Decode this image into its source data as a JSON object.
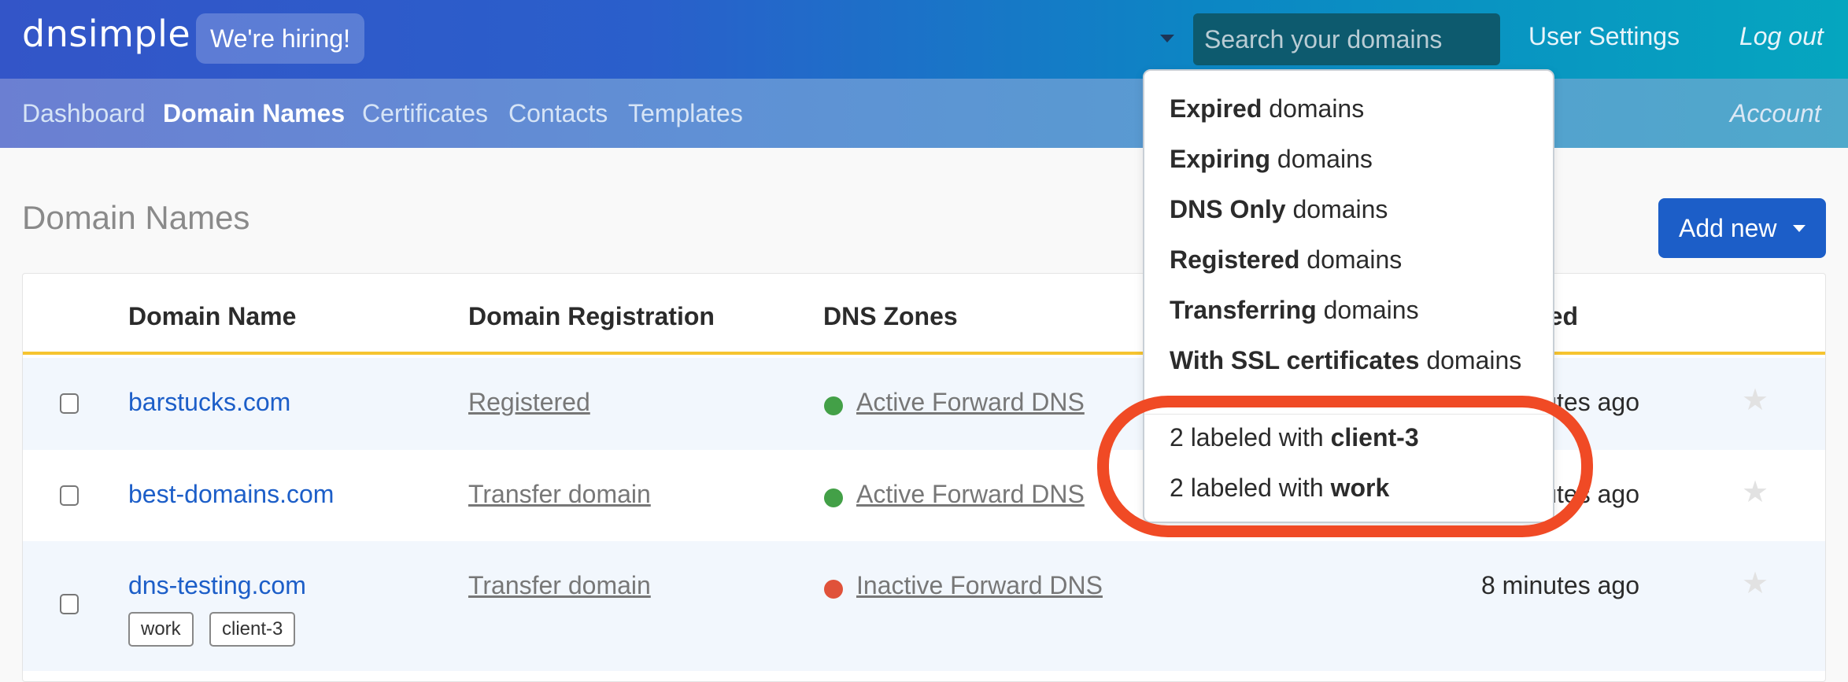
{
  "header": {
    "logo": "dnsimple",
    "hiring_badge": "We're hiring!",
    "search_placeholder": "Search your domains",
    "user_settings": "User Settings",
    "logout": "Log out"
  },
  "subnav": {
    "items": [
      {
        "label": "Dashboard",
        "active": false
      },
      {
        "label": "Domain Names",
        "active": true
      },
      {
        "label": "Certificates",
        "active": false
      },
      {
        "label": "Contacts",
        "active": false
      },
      {
        "label": "Templates",
        "active": false
      }
    ],
    "account": "Account"
  },
  "page": {
    "title": "Domain Names",
    "add_new": "Add new"
  },
  "table": {
    "columns": [
      "Domain Name",
      "Domain Registration",
      "DNS Zones",
      "Updated"
    ],
    "rows": [
      {
        "domain": "barstucks.com",
        "registration": "Registered",
        "dns_status": "active",
        "dns": "Active Forward DNS",
        "updated": "minutes ago",
        "tags": []
      },
      {
        "domain": "best-domains.com",
        "registration": "Transfer domain",
        "dns_status": "active",
        "dns": "Active Forward DNS",
        "updated": "minutes ago",
        "tags": []
      },
      {
        "domain": "dns-testing.com",
        "registration": "Transfer domain",
        "dns_status": "inactive",
        "dns": "Inactive Forward DNS",
        "updated": "8 minutes ago",
        "tags": [
          "work",
          "client-3"
        ]
      }
    ]
  },
  "dropdown": {
    "filters": [
      {
        "bold": "Expired",
        "rest": " domains"
      },
      {
        "bold": "Expiring",
        "rest": " domains"
      },
      {
        "bold": "DNS Only",
        "rest": " domains"
      },
      {
        "bold": "Registered",
        "rest": " domains"
      },
      {
        "bold": "Transferring",
        "rest": " domains"
      },
      {
        "bold": "With SSL certificates",
        "rest": " domains"
      }
    ],
    "labels": [
      {
        "prefix": "2 labeled with ",
        "bold": "client-3"
      },
      {
        "prefix": "2 labeled with ",
        "bold": "work"
      }
    ]
  },
  "colors": {
    "brand_blue": "#1c5ec8",
    "active_dns": "#43a047",
    "inactive_dns": "#e0523a",
    "header_accent": "#f6c430",
    "annotation": "#f04a25"
  }
}
